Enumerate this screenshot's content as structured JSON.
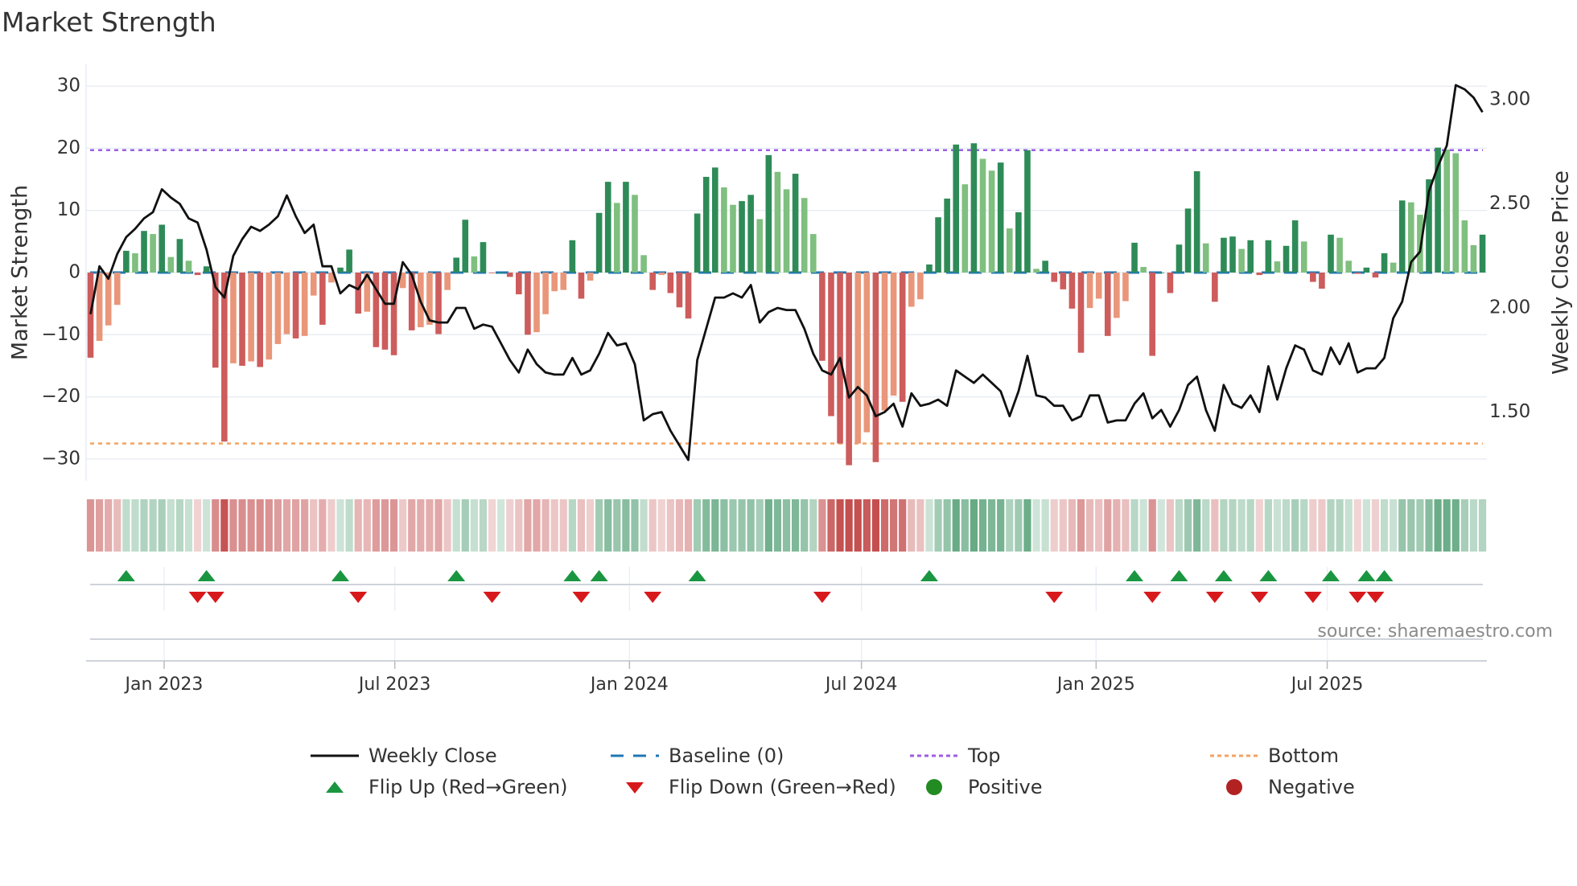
{
  "title": "Market Strength",
  "source": "source: sharemaestro.com",
  "colors": {
    "pos_rising": "#2e8b57",
    "pos_falling": "#7fbf7f",
    "neg_falling": "#cd5c5c",
    "neg_rising": "#e9967a",
    "line": "#111111",
    "baseline": "#1f77b4",
    "top": "#9b5de5",
    "bottom": "#f4a261",
    "flip_up": "#1a9641",
    "flip_down": "#d7191c",
    "positive": "#228b22",
    "negative": "#b22222"
  },
  "chart_data": {
    "type": "bar+line",
    "title": "Market Strength",
    "ylabel": "Market Strength",
    "y2label": "Weekly Close Price",
    "ylim": [
      -33.5,
      33.5
    ],
    "y2lim": [
      1.24,
      3.12
    ],
    "yticks": [
      30,
      20,
      10,
      0,
      -10,
      -20,
      -30
    ],
    "ytick_labels": [
      "30",
      "20",
      "10",
      "0",
      "−10",
      "−20",
      "−30"
    ],
    "y2ticks": [
      3.0,
      2.5,
      2.0,
      1.5
    ],
    "y2tick_labels": [
      "3.00",
      "2.50",
      "2.00",
      "1.50"
    ],
    "top_level": 19.7,
    "bottom_level": -27.5,
    "xticks": [
      {
        "week": 9.25,
        "label": "Jan 2023"
      },
      {
        "week": 35.1,
        "label": "Jul 2023"
      },
      {
        "week": 61.4,
        "label": "Jan 2024"
      },
      {
        "week": 87.4,
        "label": "Jul 2024"
      },
      {
        "week": 113.7,
        "label": "Jan 2025"
      },
      {
        "week": 139.6,
        "label": "Jul 2025"
      }
    ],
    "strength": [
      -13.7,
      -11,
      -8.5,
      -5.2,
      3.5,
      3.1,
      6.7,
      6.2,
      7.7,
      2.5,
      5.4,
      1.9,
      -0.4,
      1,
      -15.3,
      -27.2,
      -14.6,
      -15,
      -14.3,
      -15.2,
      -14,
      -11.5,
      -9.9,
      -10.6,
      -10.2,
      -3.7,
      -8.4,
      -1.6,
      0.8,
      3.7,
      -6.6,
      -6.3,
      -12,
      -12.4,
      -13.3,
      -2.5,
      -9.3,
      -8.8,
      -8.4,
      -9.9,
      -2.8,
      2.4,
      8.5,
      2.6,
      4.9,
      -0.1,
      0,
      -0.7,
      -3.5,
      -10,
      -9.6,
      -6.7,
      -3,
      -2.8,
      5.2,
      -4.2,
      -1.3,
      9.6,
      14.6,
      11.2,
      14.6,
      12.5,
      2.8,
      -2.8,
      -0.4,
      -3.3,
      -5.6,
      -7.4,
      9.5,
      15.4,
      16.9,
      13.7,
      10.9,
      11.5,
      12.5,
      8.6,
      18.9,
      16.2,
      13.4,
      15.9,
      12,
      6.2,
      -14.2,
      -23.1,
      -27.5,
      -31,
      -27.5,
      -25.7,
      -30.5,
      -22.2,
      -19.8,
      -20.8,
      -5.5,
      -4.3,
      1.3,
      8.9,
      11.9,
      20.6,
      14.2,
      20.8,
      18.3,
      16.4,
      17.7,
      7.1,
      9.7,
      19.7,
      0.6,
      1.9,
      -1.5,
      -2.7,
      -5.8,
      -12.9,
      -5.7,
      -4.2,
      -10.2,
      -7.3,
      -4.6,
      4.8,
      0.9,
      -13.4,
      0,
      -3.3,
      4.5,
      10.3,
      16.3,
      4.7,
      -4.7,
      5.6,
      5.8,
      3.8,
      5.2,
      -0.4,
      5.2,
      1.8,
      4.3,
      8.4,
      5,
      -1.5,
      -2.6,
      6.1,
      5.6,
      1.9,
      -0.2,
      0.8,
      -0.8,
      3.1,
      1.6,
      11.6,
      11.3,
      9.3,
      15,
      20.1,
      19.8,
      19.2,
      8.4,
      4.4,
      6.1
    ],
    "weekly_close": [
      1.97,
      2.2,
      2.14,
      2.26,
      2.34,
      2.38,
      2.43,
      2.46,
      2.57,
      2.53,
      2.5,
      2.43,
      2.41,
      2.28,
      2.1,
      2.05,
      2.25,
      2.33,
      2.39,
      2.37,
      2.4,
      2.44,
      2.54,
      2.44,
      2.36,
      2.4,
      2.2,
      2.2,
      2.07,
      2.11,
      2.09,
      2.16,
      2.09,
      2.02,
      2.02,
      2.22,
      2.16,
      2.03,
      1.94,
      1.93,
      1.93,
      2.0,
      2.0,
      1.9,
      1.92,
      1.91,
      1.83,
      1.75,
      1.69,
      1.8,
      1.73,
      1.69,
      1.68,
      1.68,
      1.76,
      1.68,
      1.7,
      1.78,
      1.88,
      1.82,
      1.83,
      1.73,
      1.46,
      1.49,
      1.5,
      1.41,
      1.34,
      1.27,
      1.75,
      1.9,
      2.05,
      2.05,
      2.07,
      2.05,
      2.11,
      1.93,
      1.98,
      2.0,
      1.99,
      1.99,
      1.9,
      1.78,
      1.7,
      1.68,
      1.76,
      1.57,
      1.62,
      1.58,
      1.48,
      1.5,
      1.54,
      1.43,
      1.59,
      1.53,
      1.54,
      1.56,
      1.53,
      1.7,
      1.67,
      1.64,
      1.68,
      1.64,
      1.6,
      1.48,
      1.6,
      1.77,
      1.58,
      1.57,
      1.53,
      1.53,
      1.46,
      1.48,
      1.58,
      1.58,
      1.45,
      1.46,
      1.46,
      1.54,
      1.59,
      1.47,
      1.51,
      1.43,
      1.51,
      1.63,
      1.67,
      1.51,
      1.41,
      1.63,
      1.54,
      1.52,
      1.58,
      1.5,
      1.72,
      1.56,
      1.71,
      1.82,
      1.8,
      1.7,
      1.68,
      1.81,
      1.73,
      1.83,
      1.69,
      1.71,
      1.71,
      1.76,
      1.95,
      2.03,
      2.22,
      2.27,
      2.56,
      2.68,
      2.78,
      3.07,
      3.05,
      3.01,
      2.94
    ],
    "flip_up_weeks": [
      5,
      14,
      29,
      42,
      55,
      58,
      69,
      95,
      118,
      123,
      128,
      133,
      140,
      144,
      146
    ],
    "flip_down_weeks": [
      13,
      15,
      31,
      46,
      56,
      64,
      83,
      109,
      120,
      127,
      132,
      138,
      143,
      145
    ],
    "legend": [
      {
        "label": "Weekly Close",
        "kind": "line"
      },
      {
        "label": "Baseline (0)",
        "kind": "dash"
      },
      {
        "label": "Top",
        "kind": "dot-top"
      },
      {
        "label": "Bottom",
        "kind": "dot-bottom"
      },
      {
        "label": "Flip Up (Red→Green)",
        "kind": "tri-up"
      },
      {
        "label": "Flip Down (Green→Red)",
        "kind": "tri-down"
      },
      {
        "label": "Positive",
        "kind": "circle-pos"
      },
      {
        "label": "Negative",
        "kind": "circle-neg"
      }
    ],
    "legend_position": "bottom"
  }
}
